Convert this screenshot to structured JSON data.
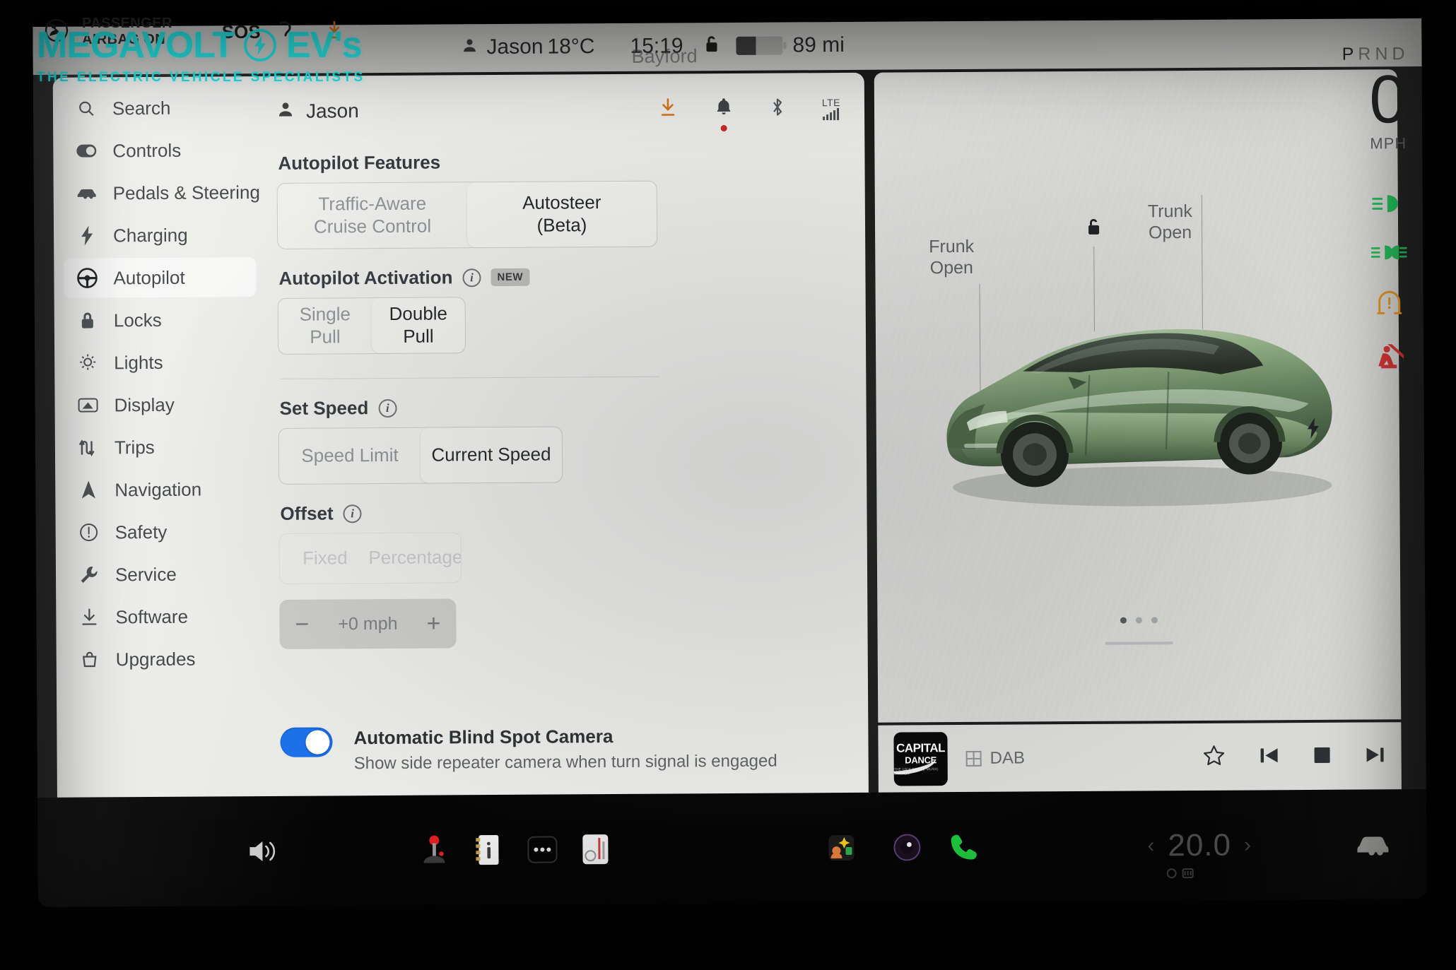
{
  "watermark": {
    "text_left": "MEGAVOLT",
    "text_right": "EV's",
    "tagline": "THE ELECTRIC VEHICLE SPECIALISTS",
    "color": "#26e2e2",
    "badge_icon": "lightning-bolt-icon"
  },
  "dashboard": {
    "airbag_line1": "PASSENGER",
    "airbag_line2": "AIRBAG ON",
    "sos_label": "SOS"
  },
  "statusbar": {
    "driver_profile": "Jason",
    "driver_icon": "person-icon",
    "temperature": "18°C",
    "clock": "15:19",
    "location": "Bayford",
    "lock_icon": "unlocked-padlock-icon",
    "battery_icon": "battery-icon",
    "battery_level_pct": 42,
    "range": "89 mi",
    "gear_letters": [
      "P",
      "R",
      "N",
      "D"
    ],
    "gear_selected": "P"
  },
  "sidebar": {
    "items": [
      {
        "label": "Search",
        "icon": "search-icon",
        "active": false
      },
      {
        "label": "Controls",
        "icon": "toggle-icon",
        "active": false
      },
      {
        "label": "Pedals & Steering",
        "icon": "car-front-icon",
        "active": false
      },
      {
        "label": "Charging",
        "icon": "lightning-bolt-icon",
        "active": false
      },
      {
        "label": "Autopilot",
        "icon": "steering-wheel-icon",
        "active": true
      },
      {
        "label": "Locks",
        "icon": "padlock-icon",
        "active": false
      },
      {
        "label": "Lights",
        "icon": "lightbulb-icon",
        "active": false
      },
      {
        "label": "Display",
        "icon": "display-icon",
        "active": false
      },
      {
        "label": "Trips",
        "icon": "route-icon",
        "active": false
      },
      {
        "label": "Navigation",
        "icon": "navigation-arrow-icon",
        "active": false
      },
      {
        "label": "Safety",
        "icon": "alert-circle-icon",
        "active": false
      },
      {
        "label": "Service",
        "icon": "wrench-icon",
        "active": false
      },
      {
        "label": "Software",
        "icon": "download-icon",
        "active": false
      },
      {
        "label": "Upgrades",
        "icon": "bag-icon",
        "active": false
      }
    ]
  },
  "content_header": {
    "profile_name": "Jason",
    "profile_icon": "person-icon",
    "icons": [
      {
        "name": "software-update-download-icon",
        "color": "#d4721a"
      },
      {
        "name": "notification-bell-icon",
        "has_dot": true,
        "dot_color": "#c62828"
      },
      {
        "name": "bluetooth-icon"
      }
    ],
    "network_label": "LTE",
    "signal_bars": 5
  },
  "settings": {
    "autopilot_features": {
      "title": "Autopilot Features",
      "options": [
        {
          "line1": "Traffic-Aware",
          "line2": "Cruise Control",
          "selected": false
        },
        {
          "line1": "Autosteer",
          "line2": "(Beta)",
          "selected": true
        }
      ]
    },
    "autopilot_activation": {
      "title": "Autopilot Activation",
      "info_icon": "info-circle-icon",
      "badge": "NEW",
      "options": [
        {
          "label": "Single Pull",
          "selected": false
        },
        {
          "label": "Double Pull",
          "selected": true
        }
      ]
    },
    "set_speed": {
      "title": "Set Speed",
      "info_icon": "info-circle-icon",
      "options": [
        {
          "label": "Speed Limit",
          "selected": false
        },
        {
          "label": "Current Speed",
          "selected": true
        }
      ]
    },
    "offset": {
      "title": "Offset",
      "info_icon": "info-circle-icon",
      "disabled": true,
      "options": [
        {
          "label": "Fixed",
          "selected": false
        },
        {
          "label": "Percentage",
          "selected": false
        }
      ],
      "stepper": {
        "minus_label": "−",
        "value": "+0 mph",
        "plus_label": "+"
      }
    },
    "blind_spot_camera": {
      "title": "Automatic Blind Spot Camera",
      "subtitle": "Show side repeater camera when turn signal is engaged",
      "enabled": true,
      "accent_color": "#1a6fe8"
    }
  },
  "carview": {
    "frunk_label_line1": "Frunk",
    "frunk_label_line2": "Open",
    "trunk_label_line1": "Trunk",
    "trunk_label_line2": "Open",
    "lock_icon": "unlocked-padlock-icon",
    "car_color": "#7d9b74",
    "page_dots": 3,
    "active_dot": 1
  },
  "media": {
    "album_line1": "CAPITAL",
    "album_line2": "DANCE",
    "album_line3": "THE UK'S DANCE MUSIC STATION",
    "source": "DAB",
    "source_icon": "radio-icon",
    "controls": [
      {
        "name": "favorite-star-icon"
      },
      {
        "name": "previous-track-icon"
      },
      {
        "name": "stop-icon"
      },
      {
        "name": "next-track-icon"
      }
    ]
  },
  "rail": {
    "speed_value": "0",
    "speed_unit": "MPH",
    "telltales": [
      {
        "name": "headlight-low-beam-icon",
        "color": "#1db954"
      },
      {
        "name": "side-marker-lights-icon",
        "color": "#1db954"
      },
      {
        "name": "tire-pressure-warning-icon",
        "color": "#e3901f"
      },
      {
        "name": "seatbelt-warning-icon",
        "color": "#d32f2f"
      }
    ],
    "charge_port_icon": "lightning-bolt-icon"
  },
  "dock": {
    "items": [
      {
        "name": "volume-icon"
      },
      {
        "name": "arcade-joystick-icon"
      },
      {
        "name": "owners-manual-icon"
      },
      {
        "name": "more-dots-icon"
      },
      {
        "name": "media-player-icon"
      },
      {
        "name": "photo-gallery-icon"
      },
      {
        "name": "camera-icon"
      },
      {
        "name": "phone-icon"
      }
    ],
    "climate_temp": "20.0",
    "climate_left_arrow": "‹",
    "climate_right_arrow": "›",
    "defrost_icon": "rear-defrost-icon",
    "car-icon": "car-icon"
  }
}
